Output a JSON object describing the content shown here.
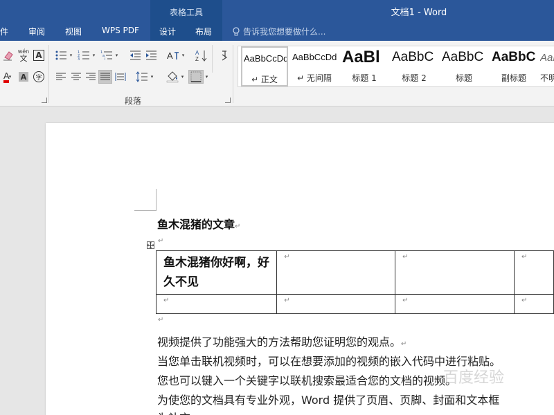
{
  "titlebar": {
    "context_group": "表格工具",
    "doc_title": "文档1 - Word",
    "tabs": [
      {
        "id": "file",
        "label": "件"
      },
      {
        "id": "review",
        "label": "审阅"
      },
      {
        "id": "view",
        "label": "视图"
      },
      {
        "id": "wps",
        "label": "WPS PDF"
      },
      {
        "id": "design",
        "label": "设计"
      },
      {
        "id": "layout",
        "label": "布局"
      }
    ],
    "tell_me": "告诉我您想要做什么..."
  },
  "ribbon": {
    "paragraph_group": "段落",
    "font_pinyin_char": "wén",
    "font_pinyin_base": "文",
    "font_box_A": "A",
    "font_shade_A": "A",
    "font_circle": "字"
  },
  "styles": [
    {
      "preview": "AaBbCcDd",
      "name": "↵ 正文"
    },
    {
      "preview": "AaBbCcDd",
      "name": "↵ 无间隔"
    },
    {
      "preview": "AaBl",
      "name": "标题 1"
    },
    {
      "preview": "AaBbC",
      "name": "标题 2"
    },
    {
      "preview": "AaBbC",
      "name": "标题"
    },
    {
      "preview": "AaBbC",
      "name": "副标题"
    },
    {
      "preview": "AaB",
      "name": "不明"
    }
  ],
  "document": {
    "heading": "鱼木混猪的文章",
    "para_mark": "↵",
    "table": {
      "rows": [
        [
          "鱼木混猪你好啊，好久不见",
          "",
          "",
          ""
        ],
        [
          "",
          "",
          "",
          ""
        ]
      ]
    },
    "lines": [
      "视频提供了功能强大的方法帮助您证明您的观点。",
      "当您单击联机视频时，可以在想要添加的视频的嵌入代码中进行粘贴。",
      "您也可以键入一个关键字以联机搜索最适合您的文档的视频。",
      "为使您的文档具有专业外观，Word 提供了页眉、页脚、封面和文本框",
      "为补充"
    ],
    "watermark": "百度经验"
  },
  "colors": {
    "title_bar": "#2b579a",
    "context_group": "#1e4e8c",
    "ribbon": "#f3f3f3",
    "canvas": "#e6e6e6"
  }
}
